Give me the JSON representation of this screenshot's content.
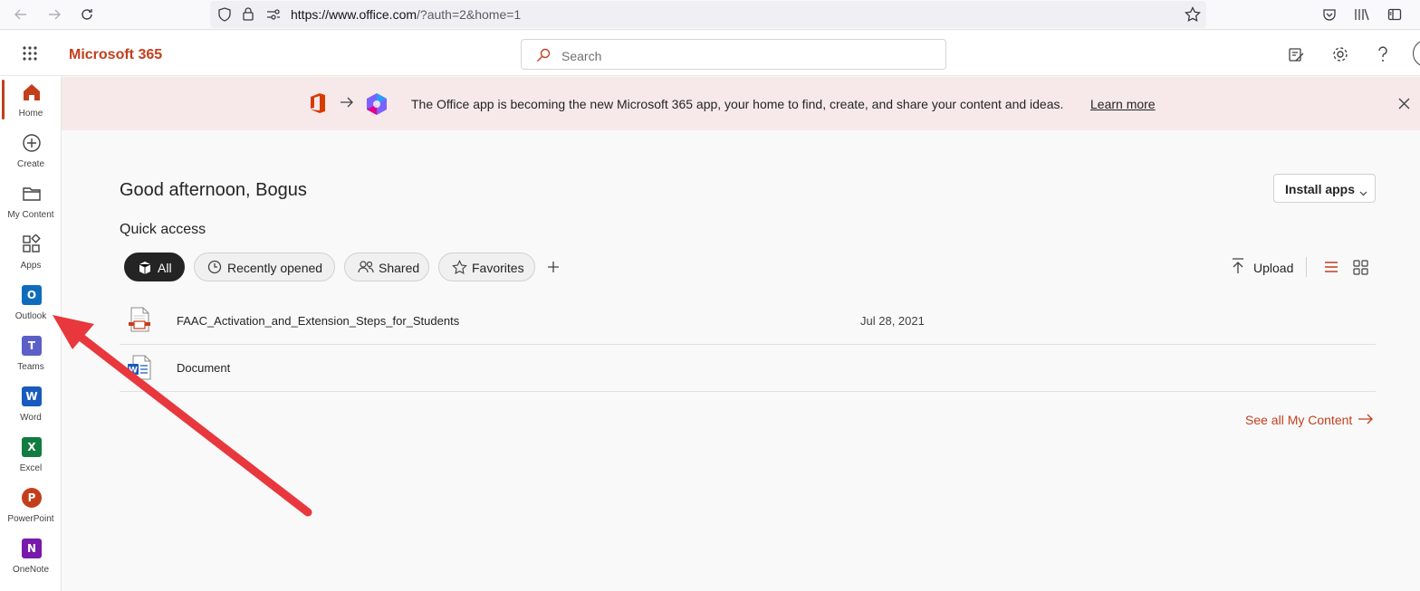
{
  "browser": {
    "url_host": "https://www.office.com",
    "url_path": "/?auth=2&home=1"
  },
  "header": {
    "brand": "Microsoft 365",
    "search_placeholder": "Search"
  },
  "rail": {
    "items": [
      {
        "label": "Home"
      },
      {
        "label": "Create"
      },
      {
        "label": "My Content"
      },
      {
        "label": "Apps"
      },
      {
        "label": "Outlook",
        "glyph": "O",
        "color": "#0f6cbd"
      },
      {
        "label": "Teams",
        "glyph": "T",
        "color": "#5b5fc7"
      },
      {
        "label": "Word",
        "glyph": "W",
        "color": "#185abd"
      },
      {
        "label": "Excel",
        "glyph": "X",
        "color": "#107c41"
      },
      {
        "label": "PowerPoint",
        "glyph": "P",
        "color": "#c43e1c"
      },
      {
        "label": "OneNote",
        "glyph": "N",
        "color": "#7719aa"
      }
    ]
  },
  "banner": {
    "text": "The Office app is becoming the new Microsoft 365 app, your home to find, create, and share your content and ideas.",
    "link": "Learn more"
  },
  "main": {
    "greeting": "Good afternoon, Bogus",
    "install_label": "Install apps",
    "quick_access_title": "Quick access",
    "filters": [
      {
        "label": "All",
        "active": true
      },
      {
        "label": "Recently opened"
      },
      {
        "label": "Shared"
      },
      {
        "label": "Favorites"
      }
    ],
    "upload_label": "Upload",
    "files": [
      {
        "name": "FAAC_Activation_and_Extension_Steps_for_Students",
        "date": "Jul 28, 2021",
        "icon": "pdf-file-icon"
      },
      {
        "name": "Document",
        "date": "",
        "icon": "word-file-icon"
      }
    ],
    "see_all": "See all My Content"
  },
  "annotation": {
    "arrow_color": "#e8383d",
    "points_to": "Outlook"
  }
}
